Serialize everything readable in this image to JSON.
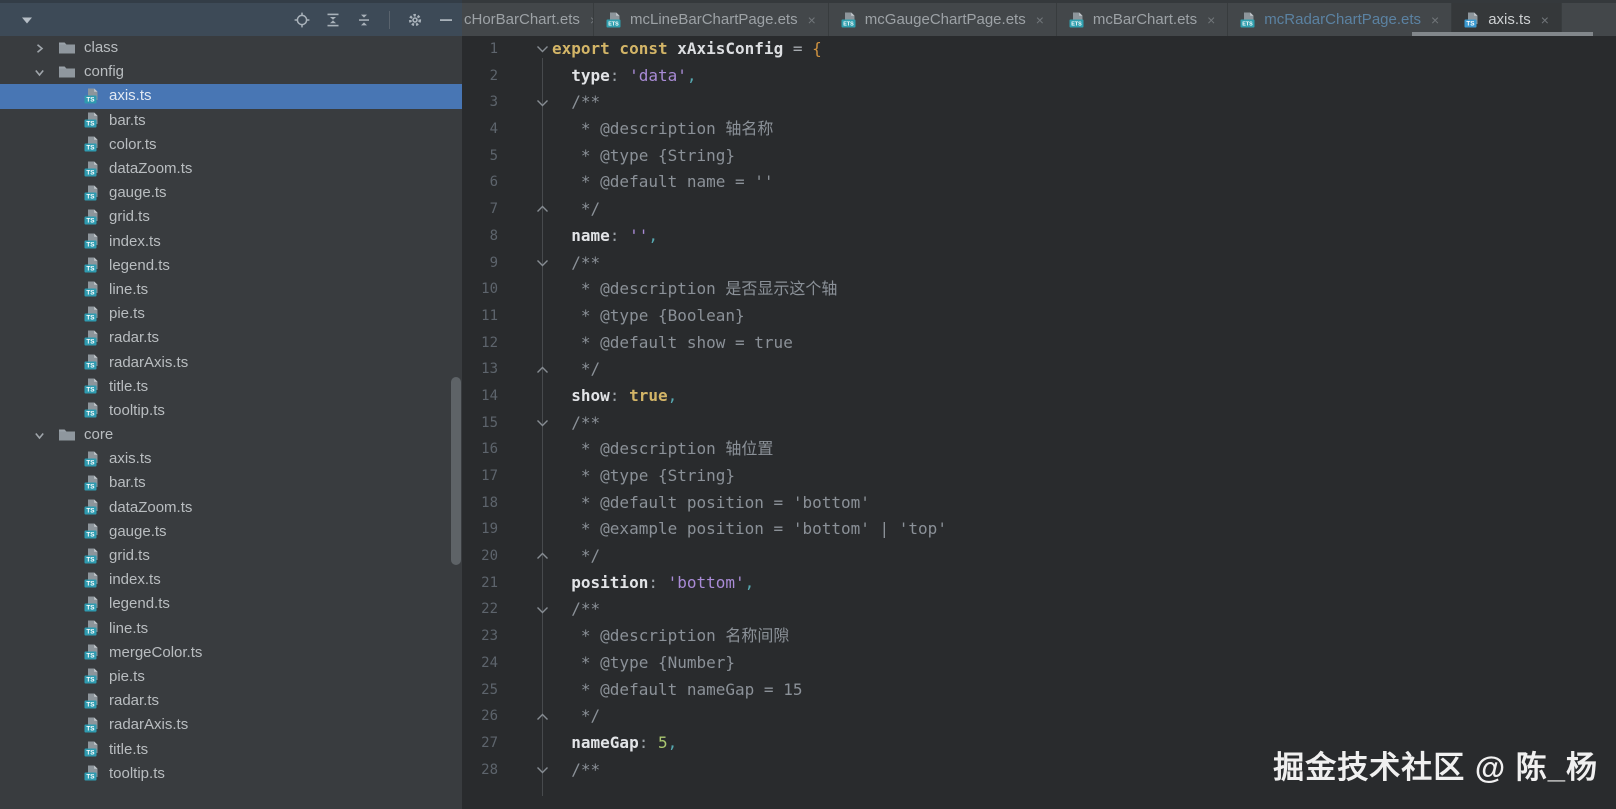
{
  "colors": {
    "selection_blue": "#4876b4",
    "ts_badge": "#3b9ad1",
    "tree_ts_badge": "#2f9bb0",
    "ets_badge": "#2f9fae",
    "modified_tab_text": "#5b82a2"
  },
  "project_panel": {
    "toolbar": {
      "left_icon": "chevron-down-icon",
      "right_icons": [
        "locate-icon",
        "expand-all-icon",
        "collapse-all-icon",
        "separator",
        "settings-gear-icon",
        "hide-panel-icon"
      ]
    },
    "tree": [
      {
        "kind": "folder",
        "label": "class",
        "expanded": false
      },
      {
        "kind": "folder",
        "label": "config",
        "expanded": true
      },
      {
        "kind": "file",
        "label": "axis.ts",
        "selected": true
      },
      {
        "kind": "file",
        "label": "bar.ts"
      },
      {
        "kind": "file",
        "label": "color.ts"
      },
      {
        "kind": "file",
        "label": "dataZoom.ts"
      },
      {
        "kind": "file",
        "label": "gauge.ts"
      },
      {
        "kind": "file",
        "label": "grid.ts"
      },
      {
        "kind": "file",
        "label": "index.ts"
      },
      {
        "kind": "file",
        "label": "legend.ts"
      },
      {
        "kind": "file",
        "label": "line.ts"
      },
      {
        "kind": "file",
        "label": "pie.ts"
      },
      {
        "kind": "file",
        "label": "radar.ts"
      },
      {
        "kind": "file",
        "label": "radarAxis.ts"
      },
      {
        "kind": "file",
        "label": "title.ts"
      },
      {
        "kind": "file",
        "label": "tooltip.ts"
      },
      {
        "kind": "folder",
        "label": "core",
        "expanded": true
      },
      {
        "kind": "file",
        "label": "axis.ts"
      },
      {
        "kind": "file",
        "label": "bar.ts"
      },
      {
        "kind": "file",
        "label": "dataZoom.ts"
      },
      {
        "kind": "file",
        "label": "gauge.ts"
      },
      {
        "kind": "file",
        "label": "grid.ts"
      },
      {
        "kind": "file",
        "label": "index.ts"
      },
      {
        "kind": "file",
        "label": "legend.ts"
      },
      {
        "kind": "file",
        "label": "line.ts"
      },
      {
        "kind": "file",
        "label": "mergeColor.ts"
      },
      {
        "kind": "file",
        "label": "pie.ts"
      },
      {
        "kind": "file",
        "label": "radar.ts"
      },
      {
        "kind": "file",
        "label": "radarAxis.ts"
      },
      {
        "kind": "file",
        "label": "title.ts"
      },
      {
        "kind": "file",
        "label": "tooltip.ts"
      }
    ]
  },
  "tabs": [
    {
      "label": "cHorBarChart.ets",
      "icon": null,
      "state": "normal",
      "close": "×"
    },
    {
      "label": "mcLineBarChartPage.ets",
      "icon": "ets",
      "state": "normal",
      "close": "×"
    },
    {
      "label": "mcGaugeChartPage.ets",
      "icon": "ets",
      "state": "normal",
      "close": "×"
    },
    {
      "label": "mcBarChart.ets",
      "icon": "ets",
      "state": "normal",
      "close": "×"
    },
    {
      "label": "mcRadarChartPage.ets",
      "icon": "ets",
      "state": "modified",
      "close": "×"
    },
    {
      "label": "axis.ts",
      "icon": "ts",
      "state": "active",
      "close": "×"
    }
  ],
  "editor": {
    "lines": [
      {
        "n": "1",
        "fold": "open",
        "tokens": [
          [
            "kw",
            "export const"
          ],
          [
            "pl",
            " "
          ],
          [
            "id",
            "xAxisConfig"
          ],
          [
            "op",
            " = "
          ],
          [
            "brace",
            "{"
          ]
        ]
      },
      {
        "n": "2",
        "tokens": [
          [
            "pl",
            "  "
          ],
          [
            "prop",
            "type"
          ],
          [
            "pun",
            ":"
          ],
          [
            "pl",
            " "
          ],
          [
            "str",
            "'data'"
          ],
          [
            "comma",
            ","
          ]
        ]
      },
      {
        "n": "3",
        "fold": "open",
        "tokens": [
          [
            "doc",
            "  /**"
          ]
        ]
      },
      {
        "n": "4",
        "tokens": [
          [
            "doc",
            "   * @description 轴名称"
          ]
        ]
      },
      {
        "n": "5",
        "tokens": [
          [
            "doc",
            "   * @type {String}"
          ]
        ]
      },
      {
        "n": "6",
        "tokens": [
          [
            "doc",
            "   * @default name = ''"
          ]
        ]
      },
      {
        "n": "7",
        "fold": "close",
        "tokens": [
          [
            "doc",
            "   */"
          ]
        ]
      },
      {
        "n": "8",
        "tokens": [
          [
            "pl",
            "  "
          ],
          [
            "prop",
            "name"
          ],
          [
            "pun",
            ":"
          ],
          [
            "pl",
            " "
          ],
          [
            "str",
            "''"
          ],
          [
            "comma",
            ","
          ]
        ]
      },
      {
        "n": "9",
        "fold": "open",
        "tokens": [
          [
            "doc",
            "  /**"
          ]
        ]
      },
      {
        "n": "10",
        "tokens": [
          [
            "doc",
            "   * @description 是否显示这个轴"
          ]
        ]
      },
      {
        "n": "11",
        "tokens": [
          [
            "doc",
            "   * @type {Boolean}"
          ]
        ]
      },
      {
        "n": "12",
        "tokens": [
          [
            "doc",
            "   * @default show = true"
          ]
        ]
      },
      {
        "n": "13",
        "fold": "close",
        "tokens": [
          [
            "doc",
            "   */"
          ]
        ]
      },
      {
        "n": "14",
        "tokens": [
          [
            "pl",
            "  "
          ],
          [
            "prop",
            "show"
          ],
          [
            "pun",
            ":"
          ],
          [
            "pl",
            " "
          ],
          [
            "kw",
            "true"
          ],
          [
            "comma",
            ","
          ]
        ]
      },
      {
        "n": "15",
        "fold": "open",
        "tokens": [
          [
            "doc",
            "  /**"
          ]
        ]
      },
      {
        "n": "16",
        "tokens": [
          [
            "doc",
            "   * @description 轴位置"
          ]
        ]
      },
      {
        "n": "17",
        "tokens": [
          [
            "doc",
            "   * @type {String}"
          ]
        ]
      },
      {
        "n": "18",
        "tokens": [
          [
            "doc",
            "   * @default position = 'bottom'"
          ]
        ]
      },
      {
        "n": "19",
        "tokens": [
          [
            "doc",
            "   * @example position = 'bottom' | 'top'"
          ]
        ]
      },
      {
        "n": "20",
        "fold": "close",
        "tokens": [
          [
            "doc",
            "   */"
          ]
        ]
      },
      {
        "n": "21",
        "tokens": [
          [
            "pl",
            "  "
          ],
          [
            "prop",
            "position"
          ],
          [
            "pun",
            ":"
          ],
          [
            "pl",
            " "
          ],
          [
            "str",
            "'bottom'"
          ],
          [
            "comma",
            ","
          ]
        ]
      },
      {
        "n": "22",
        "fold": "open",
        "tokens": [
          [
            "doc",
            "  /**"
          ]
        ]
      },
      {
        "n": "23",
        "tokens": [
          [
            "doc",
            "   * @description 名称间隙"
          ]
        ]
      },
      {
        "n": "24",
        "tokens": [
          [
            "doc",
            "   * @type {Number}"
          ]
        ]
      },
      {
        "n": "25",
        "fold": "close2",
        "tokens": [
          [
            "doc",
            "   * @default nameGap = 15"
          ]
        ]
      },
      {
        "n": "26",
        "fold": "close",
        "tokens": [
          [
            "doc",
            "   */"
          ]
        ]
      },
      {
        "n": "27",
        "tokens": [
          [
            "pl",
            "  "
          ],
          [
            "prop",
            "nameGap"
          ],
          [
            "pun",
            ":"
          ],
          [
            "pl",
            " "
          ],
          [
            "num",
            "5"
          ],
          [
            "comma",
            ","
          ]
        ]
      },
      {
        "n": "28",
        "fold": "open",
        "tokens": [
          [
            "doc",
            "  /**"
          ]
        ]
      }
    ]
  },
  "watermark": "掘金技术社区 @ 陈_杨"
}
